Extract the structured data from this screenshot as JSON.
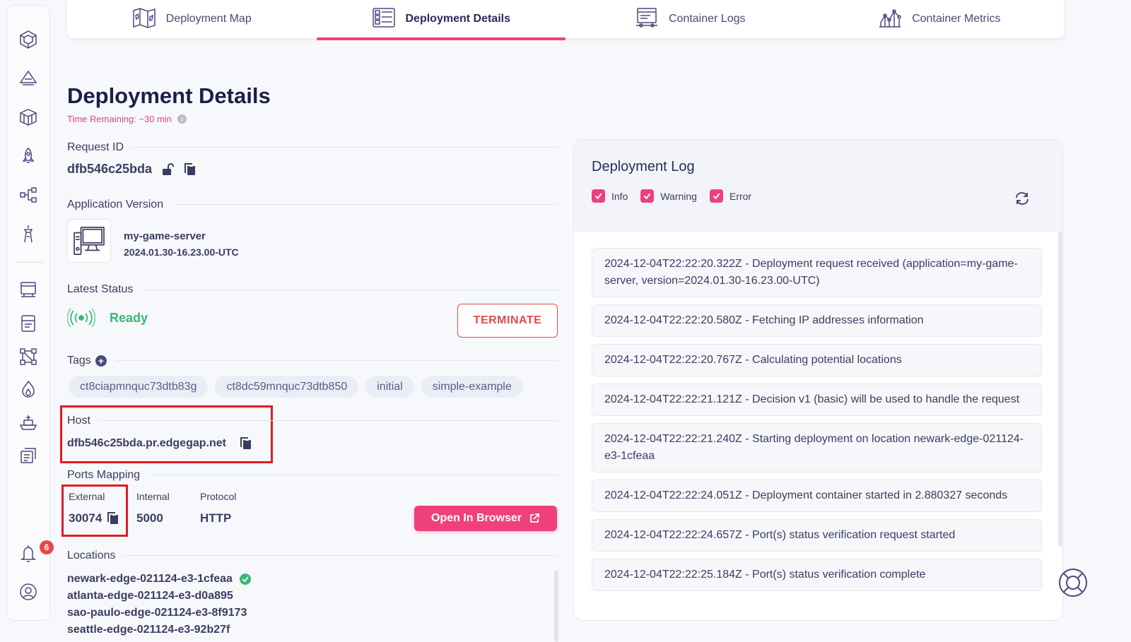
{
  "tabs": [
    {
      "label": "Deployment Map",
      "icon": "map-icon"
    },
    {
      "label": "Deployment Details",
      "icon": "details-list-icon",
      "active": true
    },
    {
      "label": "Container Logs",
      "icon": "logs-icon"
    },
    {
      "label": "Container Metrics",
      "icon": "metrics-chart-icon"
    }
  ],
  "sidebar": {
    "badge_count": "6"
  },
  "page": {
    "title": "Deployment Details",
    "time_remaining": "Time Remaining: ~30 min",
    "info_glyph": "i"
  },
  "request": {
    "label": "Request ID",
    "value": "dfb546c25bda"
  },
  "application": {
    "label": "Application Version",
    "name": "my-game-server",
    "version": "2024.01.30-16.23.00-UTC"
  },
  "status": {
    "label": "Latest Status",
    "value": "Ready",
    "terminate_label": "TERMINATE"
  },
  "tags": {
    "label": "Tags",
    "add_glyph": "+",
    "items": [
      "ct8ciapmnquc73dtb83g",
      "ct8dc59mnquc73dtb850",
      "initial",
      "simple-example"
    ]
  },
  "host": {
    "label": "Host",
    "value": "dfb546c25bda.pr.edgegap.net"
  },
  "ports": {
    "label": "Ports Mapping",
    "headers": {
      "external": "External",
      "internal": "Internal",
      "protocol": "Protocol"
    },
    "external": "30074",
    "internal": "5000",
    "protocol": "HTTP",
    "open_label": "Open In Browser"
  },
  "locations": {
    "label": "Locations",
    "items": [
      "newark-edge-021124-e3-1cfeaa",
      "atlanta-edge-021124-e3-d0a895",
      "sao-paulo-edge-021124-e3-8f9173",
      "seattle-edge-021124-e3-92b27f"
    ]
  },
  "log": {
    "title": "Deployment Log",
    "filters": [
      "Info",
      "Warning",
      "Error"
    ],
    "entries": [
      "2024-12-04T22:22:20.322Z - Deployment request received (application=my-game-server, version=2024.01.30-16.23.00-UTC)",
      "2024-12-04T22:22:20.580Z - Fetching IP addresses information",
      "2024-12-04T22:22:20.767Z - Calculating potential locations",
      "2024-12-04T22:22:21.121Z - Decision v1 (basic) will be used to handle the request",
      "2024-12-04T22:22:21.240Z - Starting deployment on location newark-edge-021124-e3-1cfeaa",
      "2024-12-04T22:22:24.051Z - Deployment container started in 2.880327 seconds",
      "2024-12-04T22:22:24.657Z - Port(s) status verification request started",
      "2024-12-04T22:22:25.184Z - Port(s) status verification complete"
    ]
  },
  "colors": {
    "accent": "#f0407a",
    "ready": "#38b878",
    "danger": "#e24b4b",
    "highlight": "#e01b24"
  }
}
